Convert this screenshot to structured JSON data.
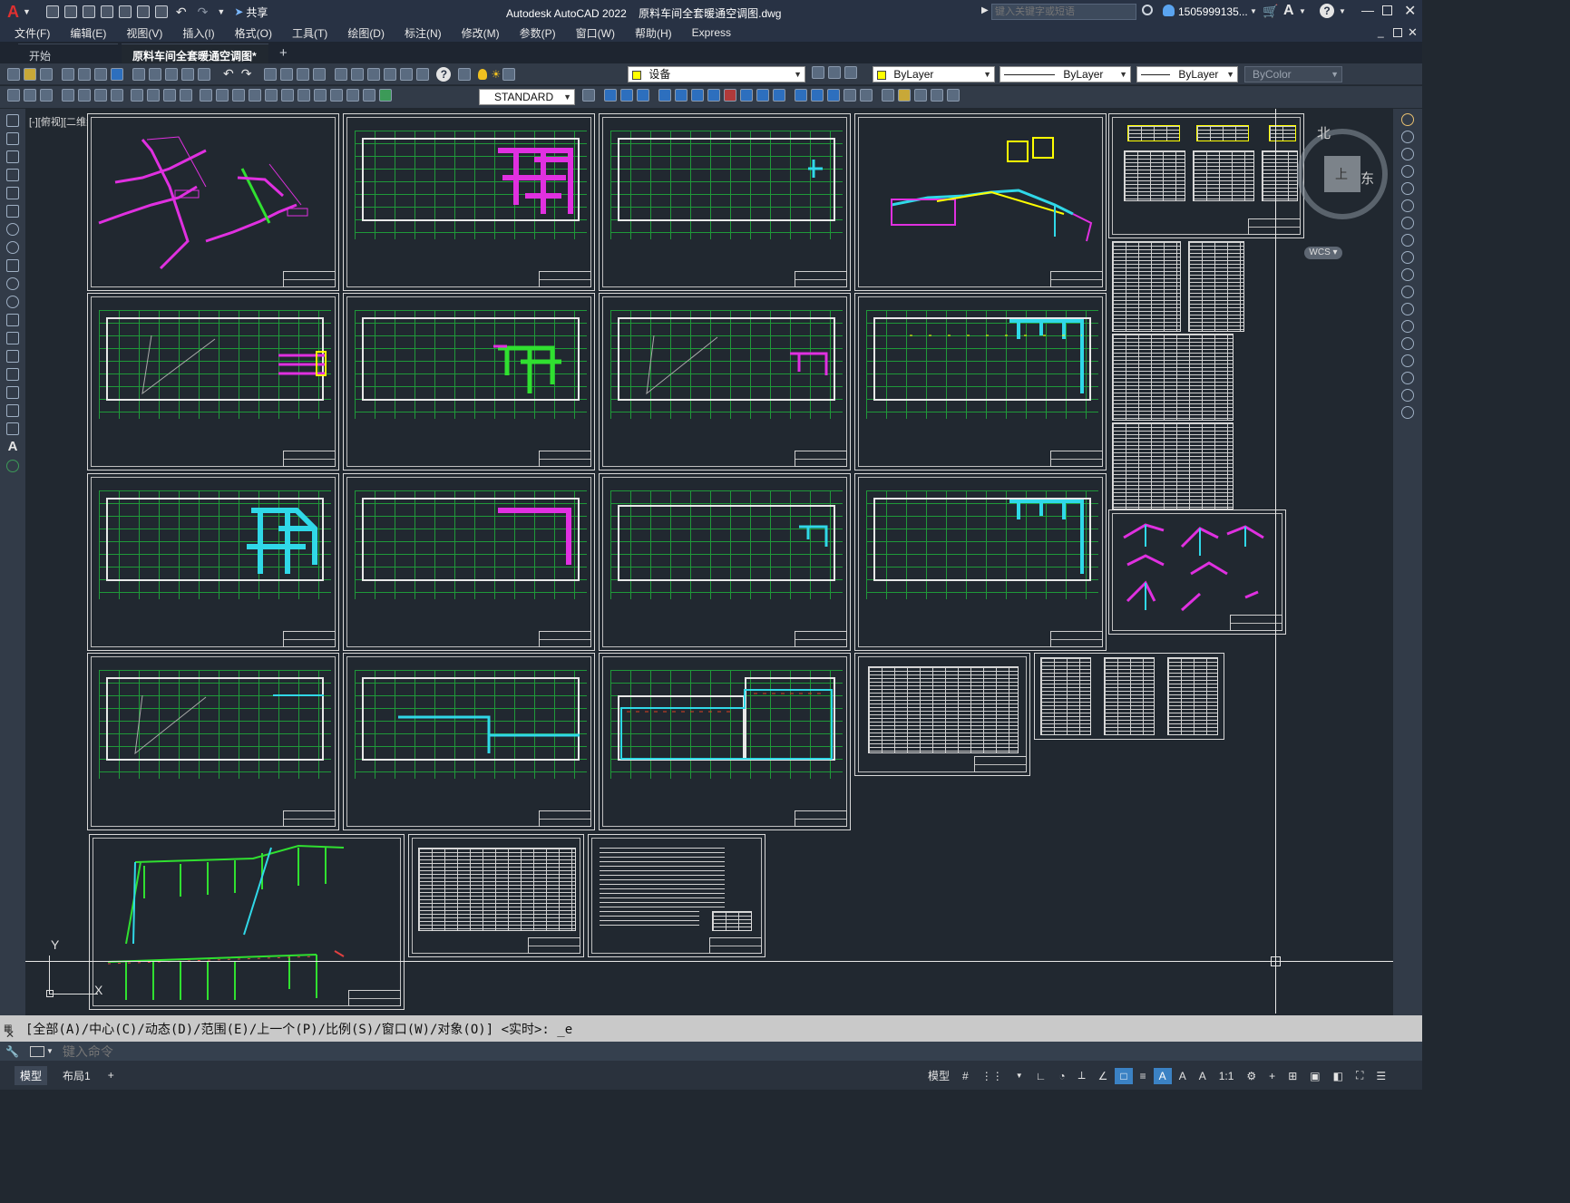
{
  "window": {
    "app_title": "Autodesk AutoCAD 2022",
    "file_name": "原料车间全套暖通空调图.dwg",
    "search_placeholder": "键入关键字或短语",
    "user": "1505999135...",
    "share": "共享"
  },
  "menu": [
    "文件(F)",
    "编辑(E)",
    "视图(V)",
    "插入(I)",
    "格式(O)",
    "工具(T)",
    "绘图(D)",
    "标注(N)",
    "修改(M)",
    "参数(P)",
    "窗口(W)",
    "帮助(H)",
    "Express"
  ],
  "tabs": {
    "start": "开始",
    "document": "原料车间全套暖通空调图*",
    "add": "+"
  },
  "toolbar": {
    "layer": "设备",
    "color": "ByLayer",
    "linetype": "ByLayer",
    "lineweight": "ByLayer",
    "plotstyle": "ByColor",
    "textstyle": "STANDARD"
  },
  "viewport": {
    "label": "[-][俯视][二维线框]",
    "compass_north": "北",
    "compass_east": "东",
    "compass_center": "上",
    "wcs": "WCS",
    "ucs_y": "Y",
    "ucs_x": "X"
  },
  "command": {
    "history": "[全部(A)/中心(C)/动态(D)/范围(E)/上一个(P)/比例(S)/窗口(W)/对象(O)] <实时>: _e",
    "placeholder": "键入命令"
  },
  "status": {
    "model_tab": "模型",
    "layout_tab": "布局1",
    "add": "+",
    "model_space": "模型",
    "scale": "1:1"
  },
  "colors": {
    "duct_magenta": "#e030e0",
    "duct_cyan": "#30d8e8",
    "duct_green": "#30e030",
    "grid_green": "#1fa63a",
    "accent": "#3b82c4"
  }
}
